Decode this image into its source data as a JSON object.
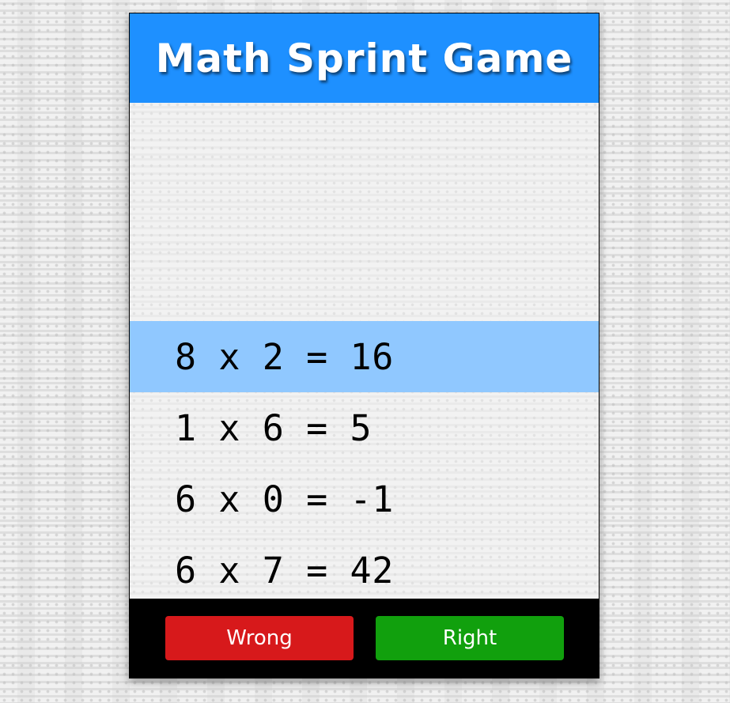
{
  "header": {
    "title": "Math Sprint Game"
  },
  "equations": [
    {
      "text": "8 x 2 = 16",
      "selected": true
    },
    {
      "text": "1 x 6 = 5",
      "selected": false
    },
    {
      "text": "6 x 0 = -1",
      "selected": false
    },
    {
      "text": "6 x 7 = 42",
      "selected": false
    }
  ],
  "footer": {
    "wrong_label": "Wrong",
    "right_label": "Right"
  },
  "colors": {
    "header_bg": "#1e90ff",
    "selected_row": "#90c8ff",
    "wrong_button": "#d7191b",
    "right_button": "#11a00d",
    "footer_bg": "#000000"
  }
}
